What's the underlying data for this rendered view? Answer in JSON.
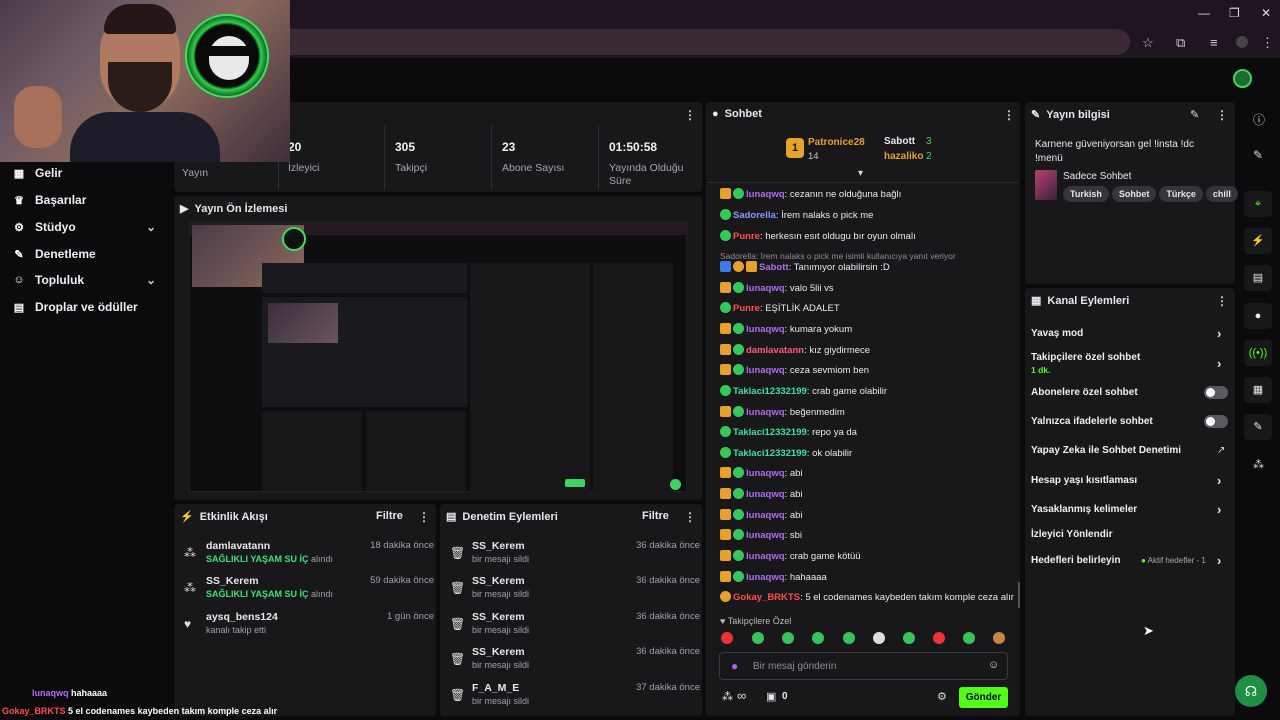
{
  "colors": {
    "accent": "#53fc18",
    "bg": "#0b0b0d",
    "panel": "#18181b",
    "green_text": "#3ee079"
  },
  "window": {
    "minimize": "—",
    "restore": "❐",
    "close": "✕"
  },
  "sidebar": {
    "items": [
      {
        "label": "Gelir",
        "icon": "money-icon"
      },
      {
        "label": "Başarılar",
        "icon": "trophy-icon"
      },
      {
        "label": "Stüdyo",
        "icon": "studio-icon",
        "chevron": "⌄"
      },
      {
        "label": "Denetleme",
        "icon": "wrench-icon"
      },
      {
        "label": "Topluluk",
        "icon": "community-icon",
        "chevron": "⌄"
      },
      {
        "label": "Droplar ve ödüller",
        "icon": "gift-icon"
      }
    ]
  },
  "stats": [
    {
      "value": "",
      "label": "Yayın"
    },
    {
      "value": "20",
      "label": "İzleyici"
    },
    {
      "value": "305",
      "label": "Takipçi"
    },
    {
      "value": "23",
      "label": "Abone Sayısı"
    },
    {
      "value": "01:50:58",
      "label": "Yayında Olduğu Süre"
    }
  ],
  "preview": {
    "title": "Yayın Ön İzlemesi"
  },
  "activity": {
    "title": "Etkinlik Akışı",
    "filter": "Filtre",
    "items": [
      {
        "name": "damlavatann",
        "sub_highlight": "SAĞLIKLI YAŞAM SU İÇ",
        "sub": "alındı",
        "time": "18 dakika önce"
      },
      {
        "name": "SS_Kerem",
        "sub_highlight": "SAĞLIKLI YAŞAM SU İÇ",
        "sub": "alındı",
        "time": "59 dakika önce"
      },
      {
        "name": "aysq_bens124",
        "sub_highlight": "",
        "sub": "kanalı takip etti",
        "time": "1 gün önce"
      }
    ]
  },
  "moderation": {
    "title": "Denetim Eylemleri",
    "filter": "Filtre",
    "items": [
      {
        "name": "SS_Kerem",
        "sub": "bir mesajı sildi",
        "time": "36 dakika önce"
      },
      {
        "name": "SS_Kerem",
        "sub": "bir mesajı sildi",
        "time": "36 dakika önce"
      },
      {
        "name": "SS_Kerem",
        "sub": "bir mesajı sildi",
        "time": "36 dakika önce"
      },
      {
        "name": "SS_Kerem",
        "sub": "bir mesajı sildi",
        "time": "36 dakika önce"
      },
      {
        "name": "F_A_M_E",
        "sub": "bir mesajı sildi",
        "time": "37 dakika önce"
      }
    ]
  },
  "chat": {
    "title": "Sohbet",
    "leaders": [
      {
        "rank": "1",
        "name": "Patronice28",
        "count": "14"
      },
      {
        "name": "Sabott",
        "count": "3"
      },
      {
        "name": "hazaliko",
        "count": "2"
      }
    ],
    "reply_note": "Sadorella: İrem nalaks o pick me isimli kullanıcıya yanıt veriyor",
    "messages": [
      {
        "user": "lunaqwq",
        "color": "#b06cf0",
        "badges": [
          "crown",
          "green"
        ],
        "text": "cezanın ne olduğuna bağlı"
      },
      {
        "user": "Sadorella",
        "color": "#8a9cff",
        "badges": [
          "green"
        ],
        "text": "İrem nalaks o pick me"
      },
      {
        "user": "Punre",
        "color": "#ff4d4d",
        "badges": [
          "green"
        ],
        "text": "herkesın esıt oldugu bır oyun olmalı"
      },
      {
        "user": "Sabott",
        "color": "#b06cf0",
        "badges": [
          "blue",
          "org",
          "crown"
        ],
        "text": "Tanımıyor olabilirsin :D"
      },
      {
        "user": "lunaqwq",
        "color": "#b06cf0",
        "badges": [
          "crown",
          "green"
        ],
        "text": "valo 5lii vs"
      },
      {
        "user": "Punre",
        "color": "#ff4d4d",
        "badges": [
          "green"
        ],
        "text": "EŞİTLİK ADALET"
      },
      {
        "user": "lunaqwq",
        "color": "#b06cf0",
        "badges": [
          "crown",
          "green"
        ],
        "text": "kumara yokum"
      },
      {
        "user": "damlavatann",
        "color": "#ff5b7a",
        "badges": [
          "crown",
          "green"
        ],
        "text": "kız giydirmece"
      },
      {
        "user": "lunaqwq",
        "color": "#b06cf0",
        "badges": [
          "crown",
          "green"
        ],
        "text": "ceza sevmiom ben"
      },
      {
        "user": "Taklaci12332199",
        "color": "#3ee0a0",
        "badges": [
          "green"
        ],
        "text": "crab game olabilir"
      },
      {
        "user": "lunaqwq",
        "color": "#b06cf0",
        "badges": [
          "crown",
          "green"
        ],
        "text": "beğenmedim"
      },
      {
        "user": "Taklaci12332199",
        "color": "#3ee0a0",
        "badges": [
          "green"
        ],
        "text": "repo ya da"
      },
      {
        "user": "Taklaci12332199",
        "color": "#3ee0a0",
        "badges": [
          "green"
        ],
        "text": "ok olabilir"
      },
      {
        "user": "lunaqwq",
        "color": "#b06cf0",
        "badges": [
          "crown",
          "green"
        ],
        "text": "abi"
      },
      {
        "user": "lunaqwq",
        "color": "#b06cf0",
        "badges": [
          "crown",
          "green"
        ],
        "text": "abi"
      },
      {
        "user": "lunaqwq",
        "color": "#b06cf0",
        "badges": [
          "crown",
          "green"
        ],
        "text": "abi"
      },
      {
        "user": "lunaqwq",
        "color": "#b06cf0",
        "badges": [
          "crown",
          "green"
        ],
        "text": "sbi"
      },
      {
        "user": "lunaqwq",
        "color": "#b06cf0",
        "badges": [
          "crown",
          "green"
        ],
        "text": "crab game kötüü"
      },
      {
        "user": "lunaqwq",
        "color": "#b06cf0",
        "badges": [
          "crown",
          "green"
        ],
        "text": "hahaaaa"
      },
      {
        "user": "Gokay_BRKTS",
        "color": "#ff4d4d",
        "badges": [
          "org"
        ],
        "text": "5 el codenames kaybeden takım komple ceza alır"
      }
    ],
    "followers_only": "Takipçilere Özel",
    "input_placeholder": "Bir mesaj gönderin",
    "points": "0",
    "send": "Gönder",
    "infinity": "∞"
  },
  "stream_info": {
    "title": "Yayın bilgisi",
    "stream_title": "Karnene güveniyorsan gel !insta !dc !menü",
    "category": "Sadece Sohbet",
    "tags": [
      "Turkish",
      "Sohbet",
      "Türkçe",
      "chill"
    ]
  },
  "channel_actions": {
    "title": "Kanal Eylemleri",
    "slow_mode": "Yavaş mod",
    "followers_chat": "Takipçilere özel sohbet",
    "followers_chat_value": "1 dk.",
    "subs_chat": "Abonelere özel sohbet",
    "emote_chat": "Yalnızca ifadelerle sohbet",
    "ai_mod": "Yapay Zeka ile Sohbet Denetimi",
    "age_limit": "Hesap yaşı kısıtlaması",
    "banned_words": "Yasaklanmış kelimeler",
    "viewer_redirect": "İzleyici Yönlendir",
    "goals": "Hedefleri belirleyin",
    "goals_status": "Aktif hedefler - 1"
  },
  "overlay_chat": [
    {
      "user": "lunaqwq",
      "text": "hahaaaa"
    },
    {
      "user": "Gokay_BRKTS",
      "text": "5 el codenames kaybeden takım komple ceza alır"
    }
  ]
}
